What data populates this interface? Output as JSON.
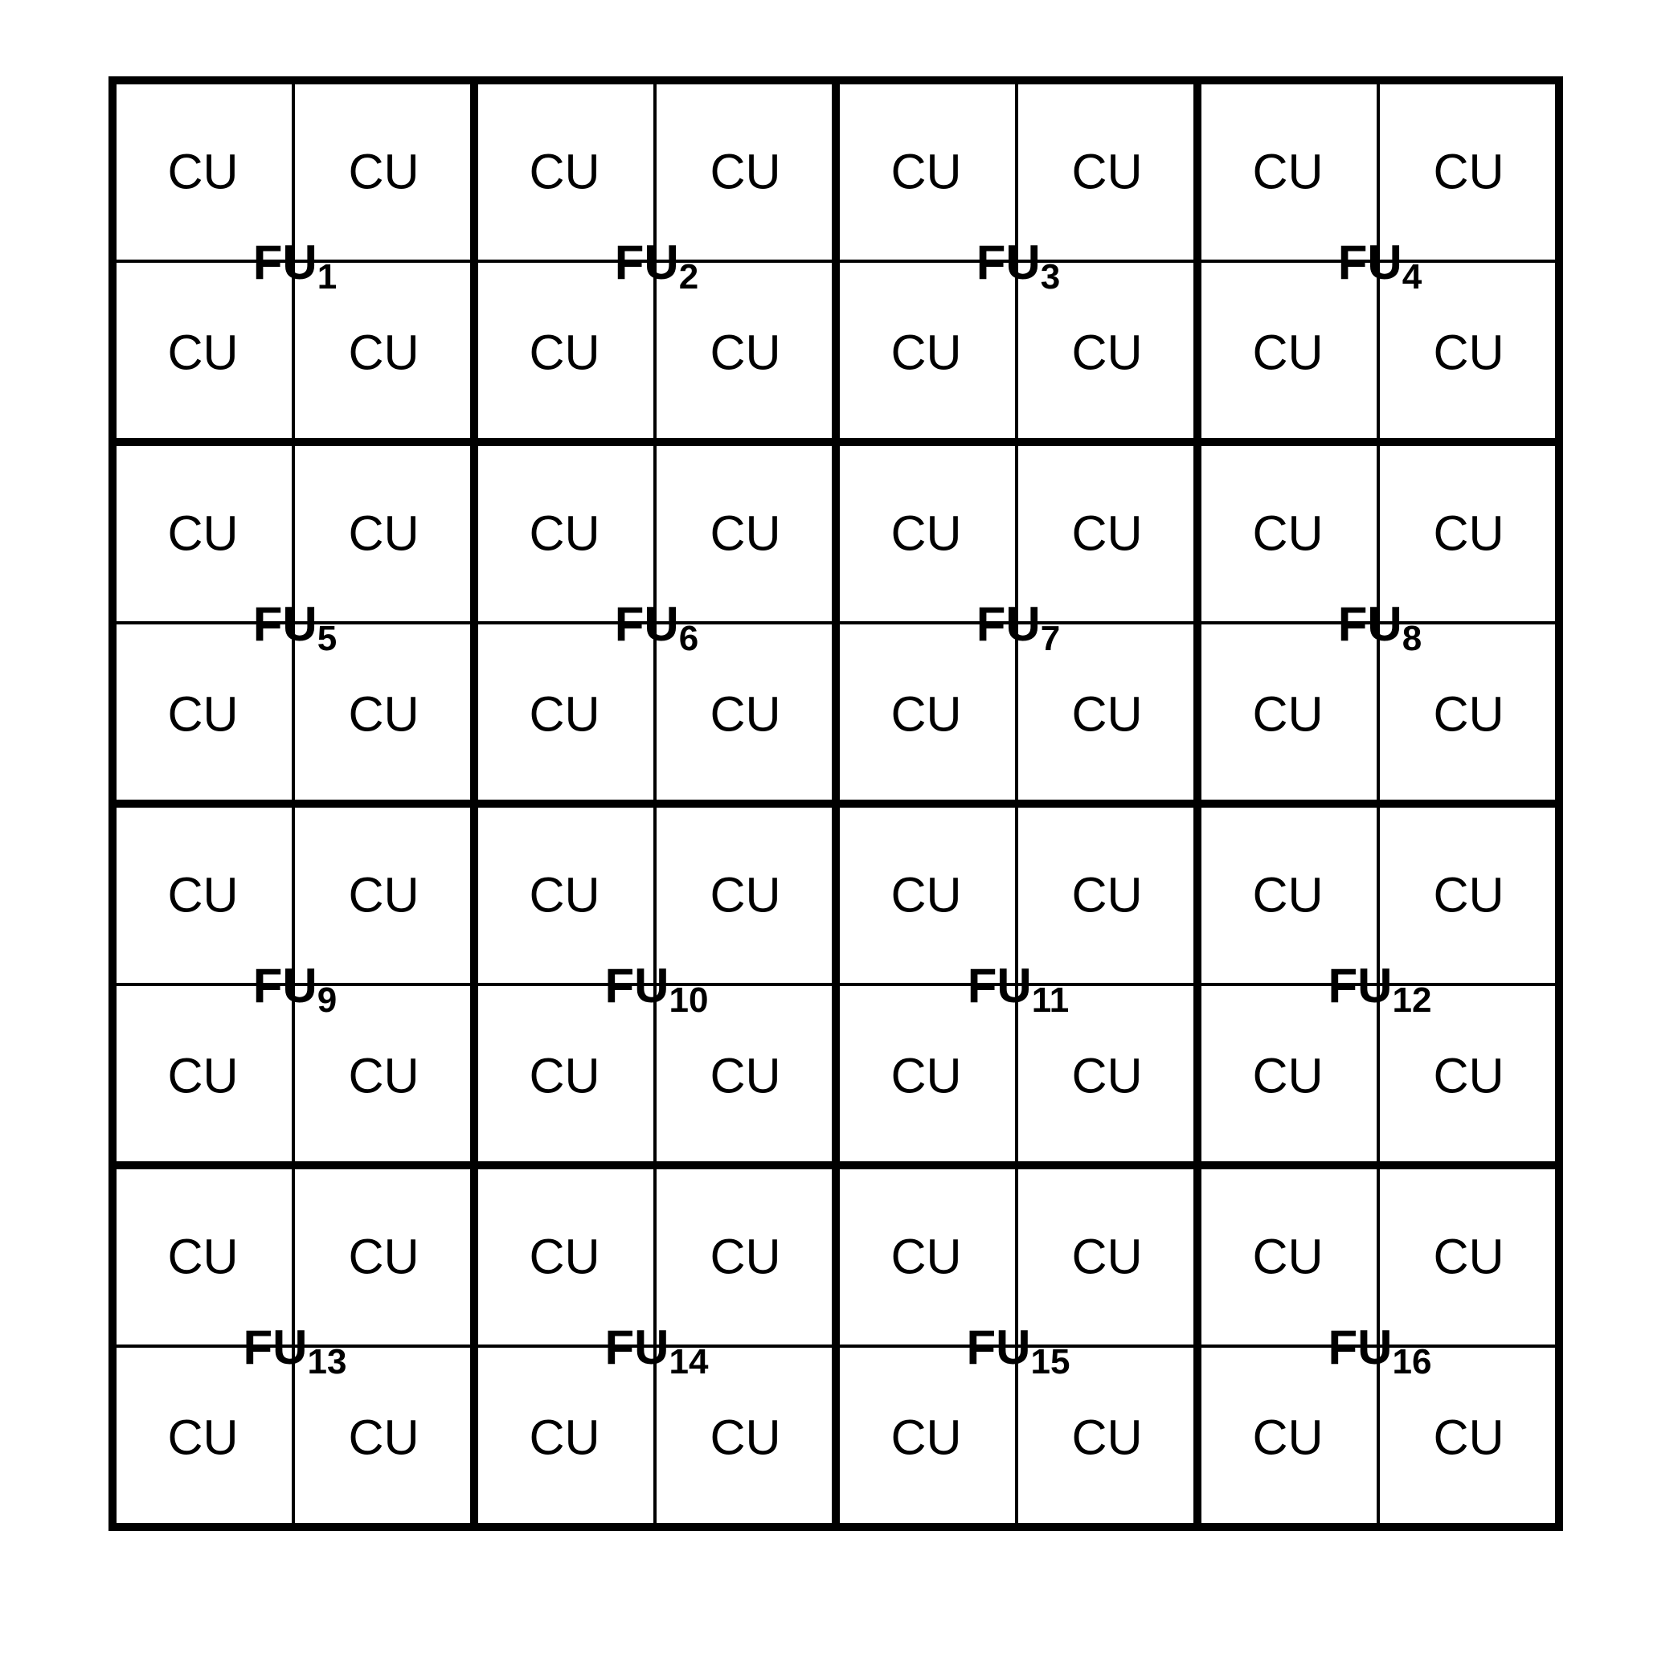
{
  "diagram": {
    "rows": 4,
    "cols": 4,
    "cu_per_fu": [
      2,
      2
    ],
    "cu_label": "CU",
    "fu_prefix": "FU",
    "line_color": "#000000",
    "background": "#ffffff",
    "fus": [
      {
        "label": "FU",
        "sub": "1"
      },
      {
        "label": "FU",
        "sub": "2"
      },
      {
        "label": "FU",
        "sub": "3"
      },
      {
        "label": "FU",
        "sub": "4"
      },
      {
        "label": "FU",
        "sub": "5"
      },
      {
        "label": "FU",
        "sub": "6"
      },
      {
        "label": "FU",
        "sub": "7"
      },
      {
        "label": "FU",
        "sub": "8"
      },
      {
        "label": "FU",
        "sub": "9"
      },
      {
        "label": "FU",
        "sub": "10"
      },
      {
        "label": "FU",
        "sub": "11"
      },
      {
        "label": "FU",
        "sub": "12"
      },
      {
        "label": "FU",
        "sub": "13"
      },
      {
        "label": "FU",
        "sub": "14"
      },
      {
        "label": "FU",
        "sub": "15"
      },
      {
        "label": "FU",
        "sub": "16"
      }
    ]
  }
}
